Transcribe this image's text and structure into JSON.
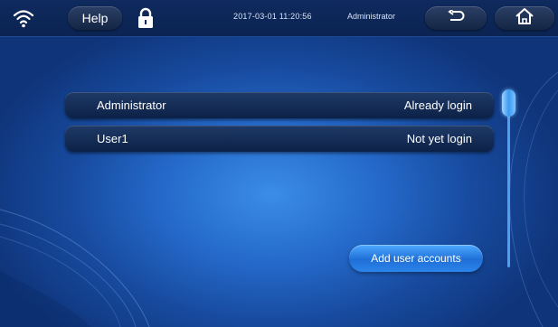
{
  "topbar": {
    "wifi_icon": "wifi-icon",
    "help_label": "Help",
    "lock_icon": "lock-icon",
    "datetime": "2017-03-01  11:20:56",
    "current_user": "Administrator",
    "back_icon": "back-arrow-icon",
    "home_icon": "home-icon"
  },
  "accounts": [
    {
      "name": "Administrator",
      "status": "Already login"
    },
    {
      "name": "User1",
      "status": "Not yet login"
    }
  ],
  "add_button_label": "Add user accounts",
  "colors": {
    "background": "#2468c8",
    "topbar": "#0f2a5e",
    "row": "#15305c",
    "accent": "#3b9af2"
  }
}
